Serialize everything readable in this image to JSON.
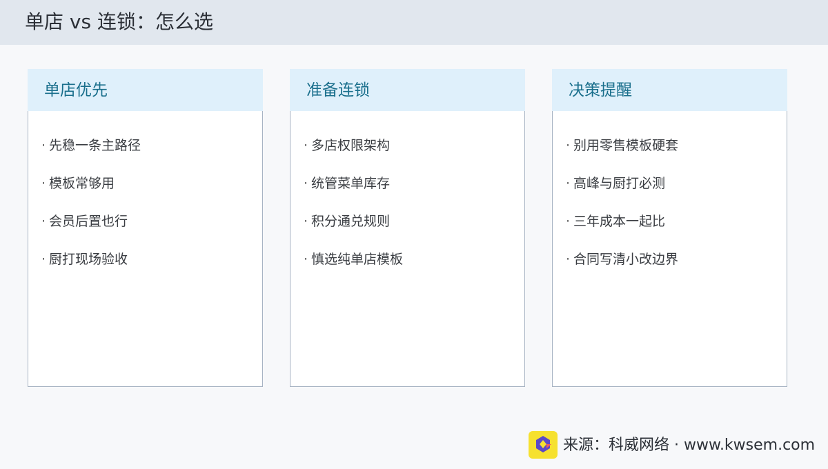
{
  "header": {
    "title": "单店 vs 连锁：怎么选"
  },
  "cards": [
    {
      "title": "单店优先",
      "items": [
        "先稳一条主路径",
        "模板常够用",
        "会员后置也行",
        "厨打现场验收"
      ]
    },
    {
      "title": "准备连锁",
      "items": [
        "多店权限架构",
        "统管菜单库存",
        "积分通兑规则",
        "慎选纯单店模板"
      ]
    },
    {
      "title": "决策提醒",
      "items": [
        "别用零售模板硬套",
        "高峰与厨打必测",
        "三年成本一起比",
        "合同写清小改边界"
      ]
    }
  ],
  "footer": {
    "source": "来源：科威网络 · www.kwsem.com",
    "logo_icon": "kwsem-logo-icon"
  },
  "colors": {
    "header_bg": "#e1e7ee",
    "card_head_bg": "#dff0fb",
    "card_title": "#1a6f8c",
    "card_border": "#a7b3c3",
    "logo_bg": "#f6e12f",
    "logo_mark": "#5b49c8"
  }
}
